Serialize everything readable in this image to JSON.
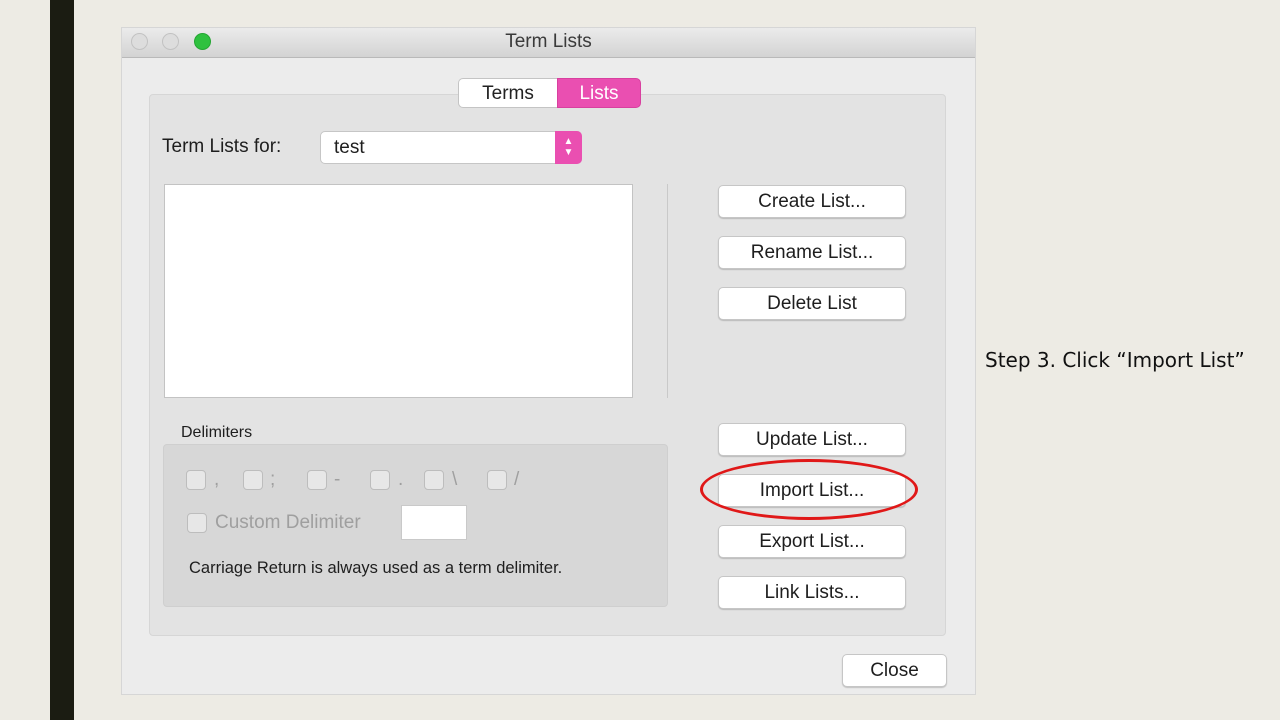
{
  "window": {
    "title": "Term Lists"
  },
  "tabs": [
    {
      "label": "Terms"
    },
    {
      "label": "Lists"
    }
  ],
  "term_lists_for": {
    "label": "Term Lists for:",
    "value": "test"
  },
  "buttons": {
    "create": "Create List...",
    "rename": "Rename List...",
    "delete": "Delete List",
    "update": "Update List...",
    "import": "Import List...",
    "export": "Export List...",
    "link": "Link Lists...",
    "close": "Close"
  },
  "delimiters": {
    "title": "Delimiters",
    "options": [
      {
        "char": ",",
        "checked": false
      },
      {
        "char": ";",
        "checked": false
      },
      {
        "char": "-",
        "checked": false
      },
      {
        "char": ".",
        "checked": false
      },
      {
        "char": "\\",
        "checked": false
      },
      {
        "char": "/",
        "checked": false
      }
    ],
    "custom_label": "Custom Delimiter",
    "custom_value": "",
    "note": "Carriage Return is always used as a term delimiter."
  },
  "instruction": "Step 3. Click “Import List”",
  "colors": {
    "accent": "#ea4fb1",
    "annotation_red": "#e01818",
    "sidebar_bar": "#1b1c12"
  }
}
